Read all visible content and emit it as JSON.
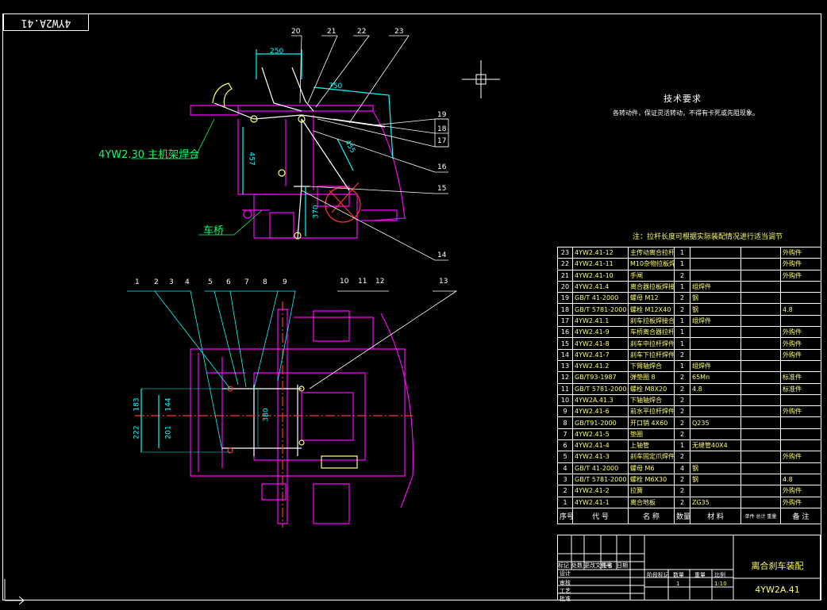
{
  "drawing": {
    "mirrored_title": "4YW2A.41",
    "tech_requirements_title": "技术要求",
    "tech_requirements_text": "各转动件，保证灵活转动，不得有卡死或先阻现象。",
    "note": "注：拉杆长度可根据实际装配情况进行适当调节",
    "label_main_frame": "4YW2.30 主机架焊合",
    "label_axle": "车桥",
    "dims": {
      "d250": "250",
      "d750": "750",
      "d457": "457",
      "d455": "455",
      "d370": "370",
      "d183": "183",
      "d222": "222",
      "d144": "144",
      "d201": "201",
      "d380": "380"
    },
    "callouts_top": [
      "20",
      "21",
      "22",
      "23"
    ],
    "callouts_right": [
      "19",
      "18",
      "17",
      "16",
      "15",
      "14"
    ],
    "callouts_bottom": [
      "10",
      "11",
      "12",
      "13"
    ],
    "callouts_plan": [
      "1",
      "2",
      "3",
      "4",
      "5",
      "6",
      "7",
      "8",
      "9"
    ]
  },
  "bom": {
    "rows": [
      {
        "no": "23",
        "code": "4YW2.41-12",
        "name": "主传动离合拉杆焊件",
        "qty": "1",
        "mat": "",
        "note": "外购件"
      },
      {
        "no": "22",
        "code": "4YW2.41-11",
        "name": "M10杂物拉板焊件",
        "qty": "1",
        "mat": "",
        "note": "外购件"
      },
      {
        "no": "21",
        "code": "4YW2.41-10",
        "name": "手闸",
        "qty": "2",
        "mat": "",
        "note": "外购件"
      },
      {
        "no": "20",
        "code": "4YW2.41.4",
        "name": "离合器拉板焊接",
        "qty": "1",
        "mat": "组焊件",
        "note": ""
      },
      {
        "no": "19",
        "code": "GB/T 41-2000",
        "name": "螺母 M12",
        "qty": "2",
        "mat": "钢",
        "note": ""
      },
      {
        "no": "18",
        "code": "GB/T 5781-2000",
        "name": "螺栓 M12X40",
        "qty": "2",
        "mat": "钢",
        "note": "4.8"
      },
      {
        "no": "17",
        "code": "4YW2.41.1",
        "name": "刹车拉板焊接合",
        "qty": "1",
        "mat": "组焊件",
        "note": ""
      },
      {
        "no": "16",
        "code": "4YW2.41-9",
        "name": "车桥离合器拉杆焊件",
        "qty": "1",
        "mat": "",
        "note": "外购件"
      },
      {
        "no": "15",
        "code": "4YW2.41-8",
        "name": "刹车中拉杆焊件",
        "qty": "1",
        "mat": "",
        "note": "外购件"
      },
      {
        "no": "14",
        "code": "4YW2.41-7",
        "name": "刹车下拉杆焊件",
        "qty": "2",
        "mat": "",
        "note": "外购件"
      },
      {
        "no": "13",
        "code": "4YW2.41.2",
        "name": "下臂轴焊合",
        "qty": "1",
        "mat": "组焊件",
        "note": ""
      },
      {
        "no": "12",
        "code": "GB/T93-1987",
        "name": "弹垫圈 8",
        "qty": "2",
        "mat": "65Mn",
        "note": "标准件"
      },
      {
        "no": "11",
        "code": "GB/T 5781-2000",
        "name": "螺栓 M8X20",
        "qty": "2",
        "mat": "4.8",
        "note": "标准件"
      },
      {
        "no": "10",
        "code": "4YW2A.41.3",
        "name": "下轴轴焊合",
        "qty": "2",
        "mat": "",
        "note": ""
      },
      {
        "no": "9",
        "code": "4YW2.41-6",
        "name": "前水平拉杆焊件",
        "qty": "2",
        "mat": "",
        "note": "外购件"
      },
      {
        "no": "8",
        "code": "GB/T91-2000",
        "name": "开口销 4X60",
        "qty": "2",
        "mat": "Q235",
        "note": ""
      },
      {
        "no": "7",
        "code": "4YW2.41-5",
        "name": "垫圈",
        "qty": "2",
        "mat": "",
        "note": ""
      },
      {
        "no": "6",
        "code": "4YW2.41-4",
        "name": "上轴管",
        "qty": "1",
        "mat": "无缝管40X4",
        "note": ""
      },
      {
        "no": "5",
        "code": "4YW2.41-3",
        "name": "刹车固定爪焊件",
        "qty": "2",
        "mat": "",
        "note": "外购件"
      },
      {
        "no": "4",
        "code": "GB/T 41-2000",
        "name": "螺母 M6",
        "qty": "4",
        "mat": "钢",
        "note": ""
      },
      {
        "no": "3",
        "code": "GB/T 5781-2000",
        "name": "螺栓 M6X30",
        "qty": "2",
        "mat": "钢",
        "note": "4.8"
      },
      {
        "no": "2",
        "code": "4YW2.41-2",
        "name": "拉簧",
        "qty": "2",
        "mat": "",
        "note": "外购件"
      },
      {
        "no": "1",
        "code": "4YW2.41-1",
        "name": "离合地板",
        "qty": "2",
        "mat": "ZG35",
        "note": "外购件"
      }
    ],
    "header": {
      "no": "序号",
      "code": "代 号",
      "name": "名 称",
      "qty": "数量",
      "mat": "材 料",
      "w": "单件 总计 重量",
      "note": "备 注"
    }
  },
  "title_block": {
    "name": "离合刹车装配",
    "code": "4YW2A.41",
    "scale": "1:10",
    "qty": "1",
    "labels": [
      "标记",
      "处数",
      "更改文件号",
      "签名",
      "日期",
      "设计",
      "审核",
      "工艺",
      "批准",
      "阶段标记",
      "数量",
      "重量",
      "比例"
    ]
  },
  "colors": {
    "line": "#ffffff",
    "part": "#ff00ff",
    "label": "#00ff66",
    "dim": "#00ffff",
    "text": "#ffff66",
    "center": "#ff3333"
  }
}
